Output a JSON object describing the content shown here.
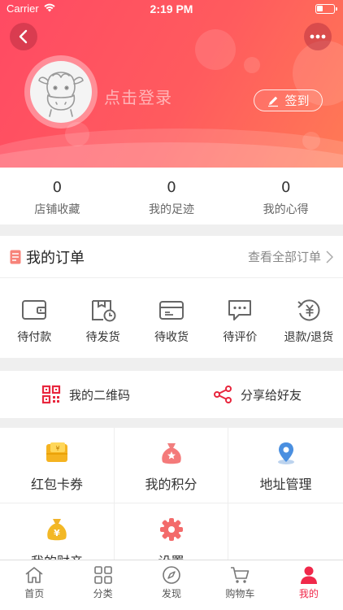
{
  "status_bar": {
    "carrier": "Carrier",
    "time": "2:19 PM"
  },
  "profile": {
    "login_text": "点击登录",
    "signin_label": "签到"
  },
  "stats": [
    {
      "value": "0",
      "label": "店铺收藏"
    },
    {
      "value": "0",
      "label": "我的足迹"
    },
    {
      "value": "0",
      "label": "我的心得"
    }
  ],
  "orders": {
    "title": "我的订单",
    "view_all": "查看全部订单",
    "items": [
      {
        "label": "待付款",
        "icon": "wallet-icon"
      },
      {
        "label": "待发货",
        "icon": "package-clock-icon"
      },
      {
        "label": "待收货",
        "icon": "truck-icon"
      },
      {
        "label": "待评价",
        "icon": "comment-icon"
      },
      {
        "label": "退款/退货",
        "icon": "refund-icon"
      }
    ]
  },
  "shortcuts": {
    "qr_label": "我的二维码",
    "share_label": "分享给好友"
  },
  "grid": [
    {
      "label": "红包卡券",
      "icon": "coupon-icon"
    },
    {
      "label": "我的积分",
      "icon": "points-bag-icon"
    },
    {
      "label": "地址管理",
      "icon": "location-pin-icon"
    },
    {
      "label": "我的财产",
      "icon": "money-bag-icon"
    },
    {
      "label": "设置",
      "icon": "settings-gear-icon"
    }
  ],
  "tabbar": [
    {
      "label": "首页",
      "icon": "home-icon"
    },
    {
      "label": "分类",
      "icon": "category-icon"
    },
    {
      "label": "发现",
      "icon": "compass-icon"
    },
    {
      "label": "购物车",
      "icon": "cart-icon"
    },
    {
      "label": "我的",
      "icon": "user-icon",
      "active": true
    }
  ],
  "colors": {
    "accent": "#f0284a",
    "header_start": "#ff4a63",
    "header_end": "#ff7a55"
  }
}
